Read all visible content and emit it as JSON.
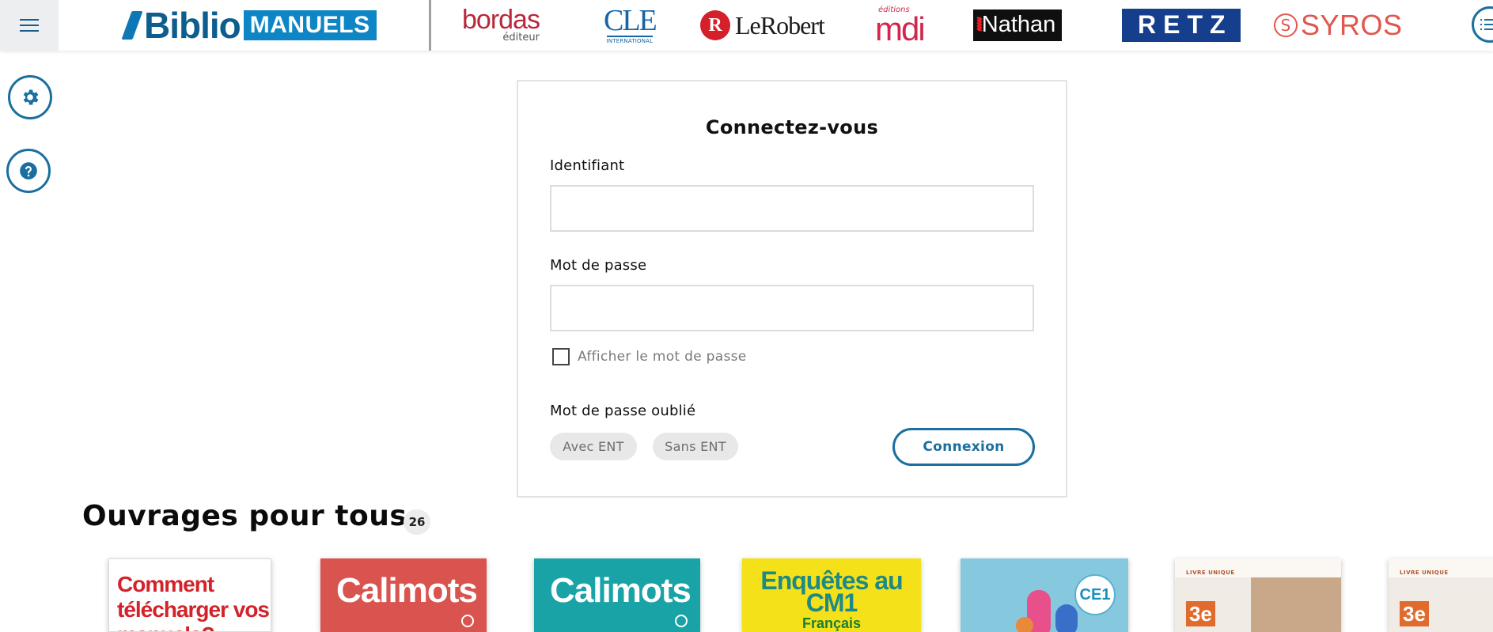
{
  "header": {
    "brand": {
      "biblio": "Biblio",
      "manuels": "MANUELS"
    },
    "publishers": [
      {
        "name": "bordas",
        "sub": "éditeur",
        "color": "#b8283a"
      },
      {
        "name": "CLE",
        "sub": "INTERNATIONAL",
        "color": "#1565a6"
      },
      {
        "name": "LeRobert",
        "mark": "R",
        "color": "#d3202a"
      },
      {
        "name": "mdi",
        "sub": "éditions",
        "color": "#d0284d"
      },
      {
        "name": "Nathan",
        "color": "#0f0f0f"
      },
      {
        "name": "RETZ",
        "color": "#153f8c"
      },
      {
        "name": "SYROS",
        "mark": "S",
        "color": "#e0574f"
      }
    ],
    "menu_icon": "hamburger-icon",
    "list_icon": "list-icon"
  },
  "sidebar": {
    "settings_icon": "gear-icon",
    "help_icon": "help-icon"
  },
  "login": {
    "title": "Connectez-vous",
    "username_label": "Identifiant",
    "username_value": "",
    "password_label": "Mot de passe",
    "password_value": "",
    "show_password_label": "Afficher le mot de passe",
    "show_password_checked": false,
    "forgot_label": "Mot de passe oublié",
    "forgot_options": [
      "Avec ENT",
      "Sans ENT"
    ],
    "submit_label": "Connexion"
  },
  "books_section": {
    "title": "Ouvrages pour tous",
    "count": "26",
    "books": [
      {
        "title": "Comment télécharger vos manuels?"
      },
      {
        "title": "Calimots"
      },
      {
        "title": "Calimots"
      },
      {
        "title": "Enquêtes au CM1",
        "subtitle": "Français"
      },
      {
        "title": "",
        "badge": "CE1"
      },
      {
        "badge": "3e",
        "header": "LIVRE UNIQUE"
      },
      {
        "badge": "3e",
        "header": "LIVRE UNIQUE"
      }
    ]
  },
  "colors": {
    "accent": "#1a6fa0",
    "brand_blue": "#0e86c6",
    "chip_bg": "#e8e8e8"
  }
}
